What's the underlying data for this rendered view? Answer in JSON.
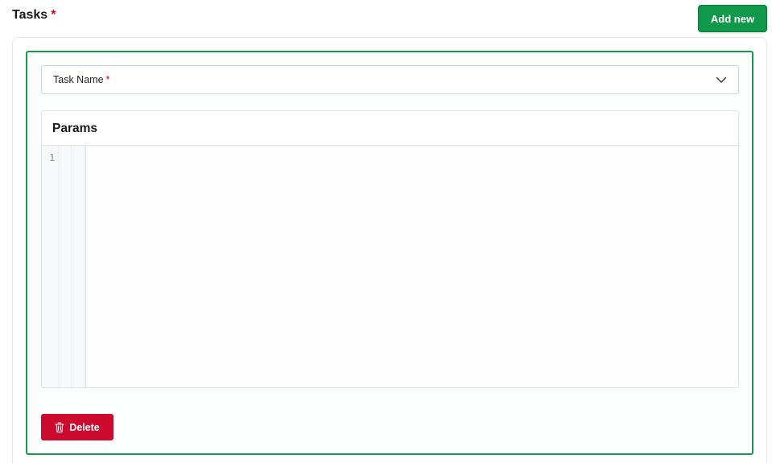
{
  "header": {
    "title": "Tasks",
    "required_mark": "*",
    "add_label": "Add new"
  },
  "task": {
    "select": {
      "label": "Task Name",
      "required_mark": "*",
      "icon": "chevron-down-icon"
    },
    "params": {
      "title": "Params",
      "line_numbers": [
        "1"
      ],
      "content": ""
    },
    "delete_label": "Delete",
    "delete_icon": "trash-icon"
  },
  "colors": {
    "accent_green": "#10994a",
    "border_green": "#169b4c",
    "danger_red": "#cc0a2e",
    "required_red": "#d0021b"
  }
}
